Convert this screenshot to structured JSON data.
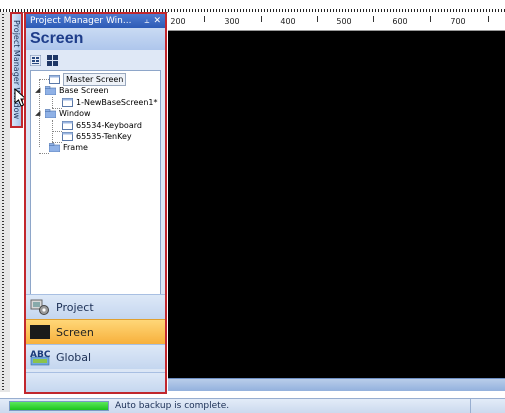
{
  "panel": {
    "title": "Project Manager Win...",
    "pin_glyph": "ᵖ",
    "close_glyph": "✕",
    "section_title": "Screen",
    "vertical_tab_label": "Project Manager Window"
  },
  "ruler": {
    "labels": [
      "200",
      "300",
      "400",
      "500",
      "600",
      "700"
    ]
  },
  "tree": {
    "items": [
      {
        "label": "Master Screen",
        "icon": "screen-icon",
        "selected": true
      },
      {
        "label": "Base Screen",
        "icon": "folder-icon"
      },
      {
        "label": "1-NewBaseScreen1*",
        "icon": "screen-icon"
      },
      {
        "label": "Window",
        "icon": "folder-icon"
      },
      {
        "label": "65534-Keyboard",
        "icon": "screen-icon"
      },
      {
        "label": "65535-TenKey",
        "icon": "screen-icon"
      },
      {
        "label": "Frame",
        "icon": "folder-icon"
      }
    ]
  },
  "nav": {
    "project": "Project",
    "screen": "Screen",
    "global": "Global",
    "global_icon_text": "ABC"
  },
  "status": {
    "text": "Auto backup is complete.",
    "progress": 1.0
  },
  "colors": {
    "highlight_border": "#c1272d",
    "active_nav": "#f7b03c",
    "canvas": "#000000",
    "progress": "#1cc41c"
  }
}
